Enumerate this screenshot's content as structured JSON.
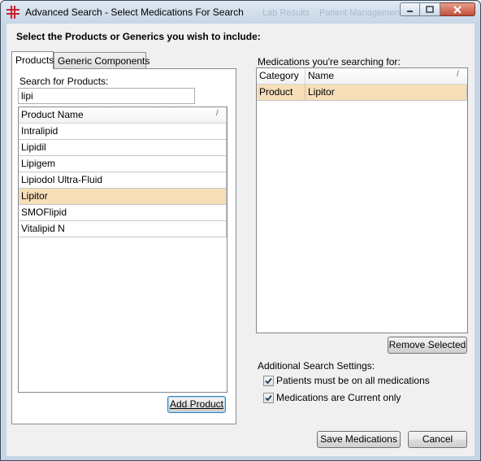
{
  "window": {
    "title": "Advanced Search - Select Medications For Search",
    "background_title_fragments": [
      "Lab Results",
      "Patient Management"
    ]
  },
  "heading": "Select the Products or Generics you wish to include:",
  "tabs": [
    {
      "label": "Products",
      "active": true
    },
    {
      "label": "Generic Components",
      "active": false
    }
  ],
  "products": {
    "search_label": "Search for Products:",
    "search_value": "lipi",
    "column_header": "Product Name",
    "items": [
      "Intralipid",
      "Lipidil",
      "Lipigem",
      "Lipiodol Ultra-Fluid",
      "Lipitor",
      "SMOFlipid",
      "Vitalipid N"
    ],
    "selected": "Lipitor",
    "add_button": "Add Product"
  },
  "medications": {
    "label": "Medications you're searching for:",
    "columns": [
      "Category",
      "Name"
    ],
    "rows": [
      {
        "category": "Product",
        "name": "Lipitor"
      }
    ],
    "remove_button": "Remove Selected"
  },
  "settings": {
    "label": "Additional Search Settings:",
    "options": [
      {
        "label": "Patients must be on all medications",
        "checked": true
      },
      {
        "label": "Medications are Current only",
        "checked": true
      }
    ]
  },
  "footer": {
    "save_button": "Save Medications",
    "cancel_button": "Cancel"
  },
  "colors": {
    "selection": "#f6deb8",
    "dialog_background": "#f0f0f0",
    "close_button": "#c24e37"
  }
}
